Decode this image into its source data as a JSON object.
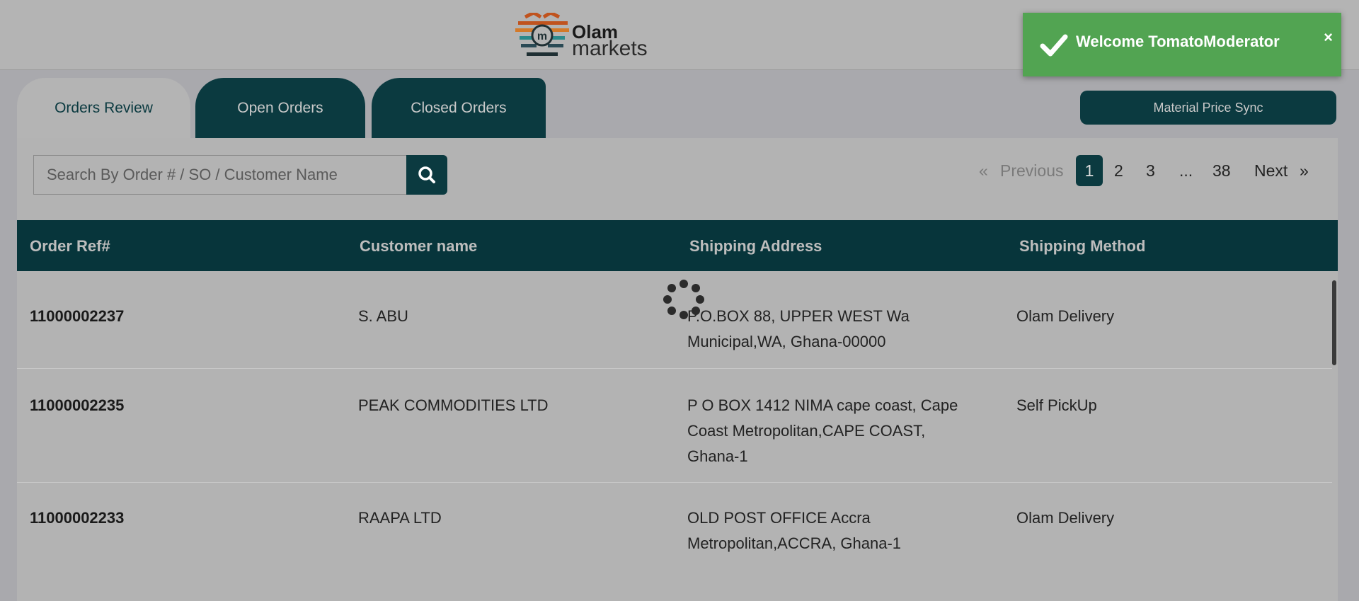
{
  "brand": {
    "logo_line1": "Olam",
    "logo_line2": "markets"
  },
  "toast": {
    "message": "Welcome TomatoModerator",
    "close_label": "×",
    "color": "#52a452"
  },
  "tabs": [
    {
      "label": "Orders Review",
      "active": true
    },
    {
      "label": "Open Orders",
      "active": false
    },
    {
      "label": "Closed Orders",
      "active": false
    }
  ],
  "actions": {
    "material_price_sync": "Material Price Sync"
  },
  "search": {
    "placeholder": "Search By Order # / SO / Customer Name"
  },
  "pagination": {
    "first": "«",
    "previous": "Previous",
    "pages": [
      "1",
      "2",
      "3",
      "...",
      "38"
    ],
    "current": "1",
    "next": "Next",
    "last": "»"
  },
  "table": {
    "headers": [
      "Order Ref#",
      "Customer name",
      "Shipping Address",
      "Shipping Method"
    ],
    "rows": [
      {
        "order_ref": "11000002237",
        "customer": "S. ABU",
        "address_lines": [
          "P.O.BOX 88, UPPER WEST Wa",
          "Municipal,WA, Ghana-00000"
        ],
        "method": "Olam Delivery"
      },
      {
        "order_ref": "11000002235",
        "customer": "PEAK COMMODITIES LTD",
        "address_lines": [
          "P O BOX 1412 NIMA cape coast, Cape",
          "Coast Metropolitan,CAPE COAST,",
          "Ghana-1"
        ],
        "method": "Self PickUp"
      },
      {
        "order_ref": "11000002233",
        "customer": "RAAPA LTD",
        "address_lines": [
          "OLD POST OFFICE Accra",
          "Metropolitan,ACCRA, Ghana-1"
        ],
        "method": "Olam Delivery"
      }
    ]
  },
  "theme": {
    "primary": "#0b3a40",
    "overlay_bg": "#a9a9ad"
  }
}
